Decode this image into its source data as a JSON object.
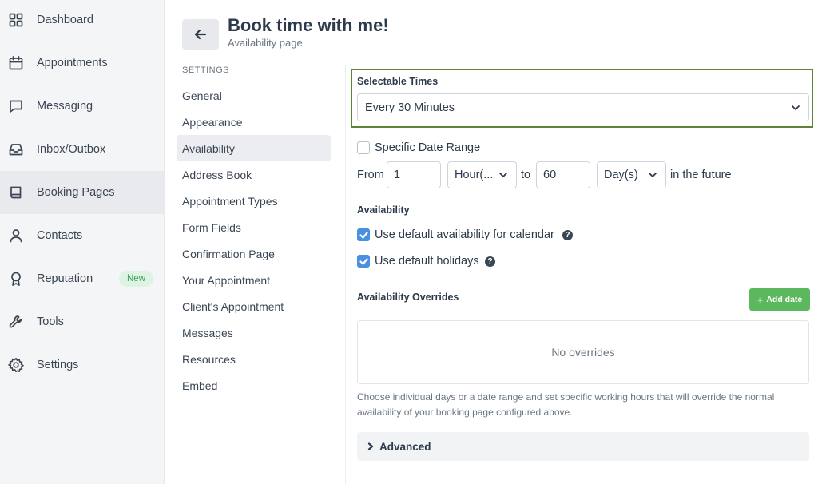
{
  "sidebar": {
    "items": [
      {
        "label": "Dashboard",
        "icon": "dashboard-icon"
      },
      {
        "label": "Appointments",
        "icon": "calendar-icon"
      },
      {
        "label": "Messaging",
        "icon": "chat-icon"
      },
      {
        "label": "Inbox/Outbox",
        "icon": "inbox-icon"
      },
      {
        "label": "Booking Pages",
        "icon": "book-icon",
        "active": true
      },
      {
        "label": "Contacts",
        "icon": "user-icon"
      },
      {
        "label": "Reputation",
        "icon": "award-icon",
        "badge": "New"
      },
      {
        "label": "Tools",
        "icon": "wrench-icon"
      },
      {
        "label": "Settings",
        "icon": "gear-icon"
      }
    ]
  },
  "header": {
    "title": "Book time with me!",
    "subtitle": "Availability page"
  },
  "settings_nav": {
    "heading": "SETTINGS",
    "items": [
      "General",
      "Appearance",
      "Availability",
      "Address Book",
      "Appointment Types",
      "Form Fields",
      "Confirmation Page",
      "Your Appointment",
      "Client's Appointment",
      "Messages",
      "Resources",
      "Embed"
    ],
    "active": "Availability"
  },
  "main": {
    "selectable_times": {
      "label": "Selectable Times",
      "value": "Every 30 Minutes"
    },
    "date_range": {
      "checkbox_label": "Specific Date Range",
      "checked": false,
      "from_label": "From",
      "from_value": "1",
      "from_unit": "Hour(...",
      "to_label": "to",
      "to_value": "60",
      "to_unit": "Day(s)",
      "suffix": "in the future"
    },
    "availability": {
      "label": "Availability",
      "default_calendar_label": "Use default availability for calendar",
      "default_calendar_checked": true,
      "default_holidays_label": "Use default holidays",
      "default_holidays_checked": true,
      "help_glyph": "?"
    },
    "overrides": {
      "label": "Availability Overrides",
      "add_button": "Add date",
      "add_icon": "+",
      "empty_text": "No overrides",
      "help_text": "Choose individual days or a date range and set specific working hours that will override the normal availability of your booking page configured above."
    },
    "advanced": {
      "label": "Advanced"
    }
  },
  "colors": {
    "highlight_border": "#5f8436",
    "checkbox": "#4a90e2",
    "add_button": "#5cb85c",
    "badge_bg": "#dff3e4",
    "badge_text": "#3aa45a"
  }
}
